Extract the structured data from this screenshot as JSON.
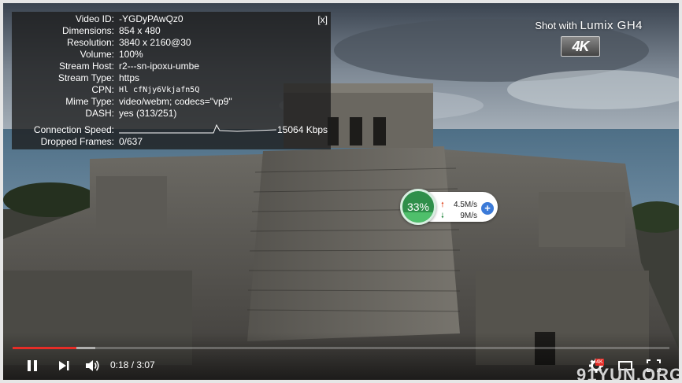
{
  "stats": {
    "close_label": "[x]",
    "rows": [
      {
        "key": "Video ID:",
        "value": "-YGDyPAwQz0"
      },
      {
        "key": "Dimensions:",
        "value": "854 x 480"
      },
      {
        "key": "Resolution:",
        "value": "3840 x 2160@30"
      },
      {
        "key": "Volume:",
        "value": "100%"
      },
      {
        "key": "Stream Host:",
        "value": "r2---sn-ipoxu-umbe"
      },
      {
        "key": "Stream Type:",
        "value": "https"
      },
      {
        "key": "CPN:",
        "value": "Hl cfNjy6Vkjafn5Q"
      },
      {
        "key": "Mime Type:",
        "value": "video/webm; codecs=\"vp9\""
      },
      {
        "key": "DASH:",
        "value": "yes (313/251)"
      },
      {
        "key": "Connection Speed:",
        "value": "15064 Kbps"
      },
      {
        "key": "Dropped Frames:",
        "value": "0/637"
      }
    ]
  },
  "watermark": {
    "text": "Shot with",
    "brand": "Lumix GH4",
    "badge": "4K"
  },
  "speed_widget": {
    "percent_label": "33%",
    "percent": 33,
    "upload": "4.5M/s",
    "download": "9M/s",
    "plus_label": "+"
  },
  "player": {
    "played_fraction": 0.0973,
    "buffered_fraction": 0.126,
    "time_label": "0:18 / 3:07",
    "hd_badge": "4K"
  },
  "site_watermark": "91YUN.ORG",
  "colors": {
    "progress_played": "#e52d27",
    "speed_up": "#e0502a",
    "speed_down": "#2f8f4a",
    "plus_button": "#3b7ad8"
  }
}
